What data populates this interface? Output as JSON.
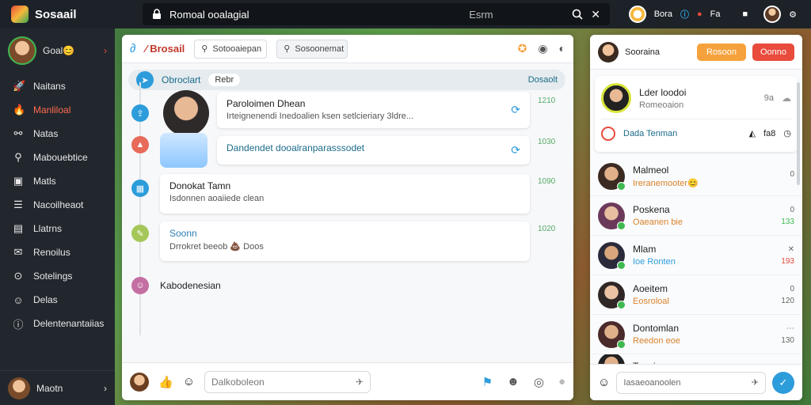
{
  "topbar": {
    "brand": "Sosaail",
    "search_value": "Romoal ooalagial",
    "search_mid": "Esrm",
    "user_label": "Bora",
    "fa_label": "Fa"
  },
  "sidebar": {
    "user_name": "Goal😊",
    "items": [
      {
        "label": "Naitans",
        "icon": "rocket-icon"
      },
      {
        "label": "Manliloal",
        "icon": "fire-icon",
        "active": true
      },
      {
        "label": "Natas",
        "icon": "link-icon"
      },
      {
        "label": "Mabouebtice",
        "icon": "search-icon"
      },
      {
        "label": "Matls",
        "icon": "briefcase-icon"
      },
      {
        "label": "Nacoilheaot",
        "icon": "list-icon"
      },
      {
        "label": "Llatrns",
        "icon": "book-icon"
      },
      {
        "label": "Renoilus",
        "icon": "inbox-icon"
      },
      {
        "label": "Sotelings",
        "icon": "gear-icon"
      },
      {
        "label": "Delas",
        "icon": "user-icon"
      },
      {
        "label": "Delentenantaiias",
        "icon": "info-icon"
      }
    ],
    "bottom_name": "Maotn"
  },
  "center": {
    "title": "Brosail",
    "field1": "Sotooaiepan",
    "field2": "Sosoonemat",
    "channel": {
      "name": "Obroclart",
      "pill": "Rebr",
      "right": "Dosaolt"
    },
    "messages": [
      {
        "title": "Paroloimen Dhean",
        "sub": "Irteignenendi Inedoalien ksen setlcieriary 3ldre...",
        "time": "1210"
      },
      {
        "title": "Dandendet dooalranparasssodet",
        "sub": "",
        "time": "1030"
      },
      {
        "title": "Donokat Tamn",
        "sub": "Isdonnen aoaiiede clean",
        "time": "1090"
      },
      {
        "title": "Soonn",
        "sub": "Drrokret beeob 💩 Doos",
        "time": "1020"
      }
    ],
    "last_item": "Kabodenesian",
    "input_placeholder": "Dalkoboleon"
  },
  "right": {
    "header_name": "Sooraina",
    "btn_orange": "Rosoon",
    "btn_red": "Oonno",
    "top_card": {
      "name": "Lder loodoi",
      "sub": "Romeoaion",
      "meta": "9a"
    },
    "dt_label": "Dada Tenman",
    "dt_meta": "fa8",
    "contacts": [
      {
        "name": "Malmeol",
        "status": "Ireranemooter😊",
        "meta": "0",
        "value": ""
      },
      {
        "name": "Poskena",
        "status": "Oaeanen bie",
        "meta": "0",
        "value": "133"
      },
      {
        "name": "Mlam",
        "status": "Ioe Ronten",
        "meta": "",
        "value": "193"
      },
      {
        "name": "Aoeitem",
        "status": "Eosroloal",
        "meta": "0",
        "value": "120"
      },
      {
        "name": "Dontomlan",
        "status": "Reedon eoe",
        "meta": "",
        "value": "130"
      },
      {
        "name": "Tonnie",
        "status": "",
        "meta": "",
        "value": ""
      }
    ],
    "input_placeholder": "Iasaeoanoolen"
  },
  "colors": {
    "accent": "#2d9cdb",
    "brand_red": "#e94b3c",
    "orange": "#f6a23c",
    "sidebar_bg": "#22272e"
  }
}
